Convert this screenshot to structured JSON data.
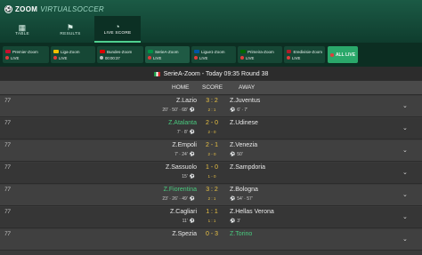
{
  "app": {
    "logo_brand": "ZOOM",
    "logo_sub": "VIRTUALSOCCER"
  },
  "nav": [
    {
      "label": "TABLE",
      "icon": "table-icon"
    },
    {
      "label": "RESULTS",
      "icon": "results-icon"
    },
    {
      "label": "LIVE SCORE",
      "icon": "live-score-icon",
      "active": true
    }
  ],
  "leagues": [
    {
      "name": "Premier-Zoom",
      "status": "LIVE",
      "flag": "#c8102e"
    },
    {
      "name": "Liga-Zoom",
      "status": "LIVE",
      "flag": "#f1bf00"
    },
    {
      "name": "Bundes-Zoom",
      "status": "00:00:37",
      "flag": "#dd0000"
    },
    {
      "name": "SerieA-Zoom",
      "status": "LIVE",
      "flag": "#009246"
    },
    {
      "name": "Ligue1-Zoom",
      "status": "LIVE",
      "flag": "#0055a4"
    },
    {
      "name": "Primeira-Zoom",
      "status": "LIVE",
      "flag": "#006600"
    },
    {
      "name": "Eredivisie-Zoom",
      "status": "LIVE",
      "flag": "#ae1c28"
    },
    {
      "name": "ALL LIVE",
      "all": true
    }
  ],
  "round_title": "SerieA-Zoom - Today 09:35 Round 38",
  "columns": {
    "home": "HOME",
    "score": "SCORE",
    "away": "AWAY"
  },
  "matches": [
    {
      "minute": "77",
      "home": "Z.Lazio",
      "score": "3 : 2",
      "away": "Z.Juventus",
      "home_goals": "20' · 50' · 68'",
      "ht": "2 : 1",
      "away_goals": "6' · 7'",
      "winner": ""
    },
    {
      "minute": "77",
      "home": "Z.Atalanta",
      "score": "2 - 0",
      "away": "Z.Udinese",
      "home_goals": "7' · 8'",
      "ht": "2 - 0",
      "away_goals": "",
      "winner": "home"
    },
    {
      "minute": "77",
      "home": "Z.Empoli",
      "score": "2 - 1",
      "away": "Z.Venezia",
      "home_goals": "7' · 24'",
      "ht": "2 - 0",
      "away_goals": "50'",
      "winner": ""
    },
    {
      "minute": "77",
      "home": "Z.Sassuolo",
      "score": "1 - 0",
      "away": "Z.Sampdoria",
      "home_goals": "15'",
      "ht": "1 - 0",
      "away_goals": "",
      "winner": ""
    },
    {
      "minute": "77",
      "home": "Z.Fiorentina",
      "score": "3 : 2",
      "away": "Z.Bologna",
      "home_goals": "23' · 26' · 49'",
      "ht": "2 : 1",
      "away_goals": "54' · 57'",
      "winner": "home"
    },
    {
      "minute": "77",
      "home": "Z.Cagliari",
      "score": "1 : 1",
      "away": "Z.Hellas Verona",
      "home_goals": "11'",
      "ht": "1 : 1",
      "away_goals": "3'",
      "winner": ""
    },
    {
      "minute": "77",
      "home": "Z.Spezia",
      "score": "0 - 3",
      "away": "Z.Torino",
      "home_goals": "",
      "ht": "",
      "away_goals": "",
      "winner": "away"
    }
  ]
}
